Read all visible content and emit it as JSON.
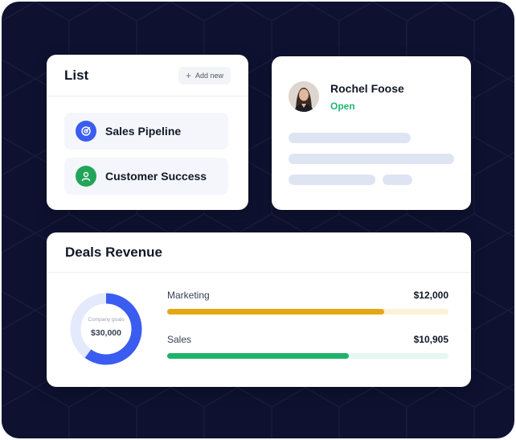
{
  "list_card": {
    "title": "List",
    "add_label": "Add new",
    "items": [
      {
        "label": "Sales Pipeline",
        "icon": "target-icon",
        "color": "#3b5cf0"
      },
      {
        "label": "Customer Success",
        "icon": "user-icon",
        "color": "#22a559"
      }
    ]
  },
  "profile_card": {
    "name": "Rochel Foose",
    "status": "Open",
    "status_color": "#22b573"
  },
  "revenue_card": {
    "title": "Deals Revenue",
    "goal_caption": "Company goals",
    "goal_value": "$30,000",
    "goal_progress": 0.6,
    "metrics": [
      {
        "label": "Marketing",
        "amount": "$12,000",
        "progress": 0.77,
        "color": "#e5a711",
        "track": "#fdf1d6"
      },
      {
        "label": "Sales",
        "amount": "$10,905",
        "progress": 0.645,
        "color": "#1fb26b",
        "track": "#e5f7ee"
      }
    ]
  },
  "colors": {
    "background": "#0e1230",
    "accent_blue": "#3b5cf0",
    "skeleton": "#dfe4f3"
  }
}
